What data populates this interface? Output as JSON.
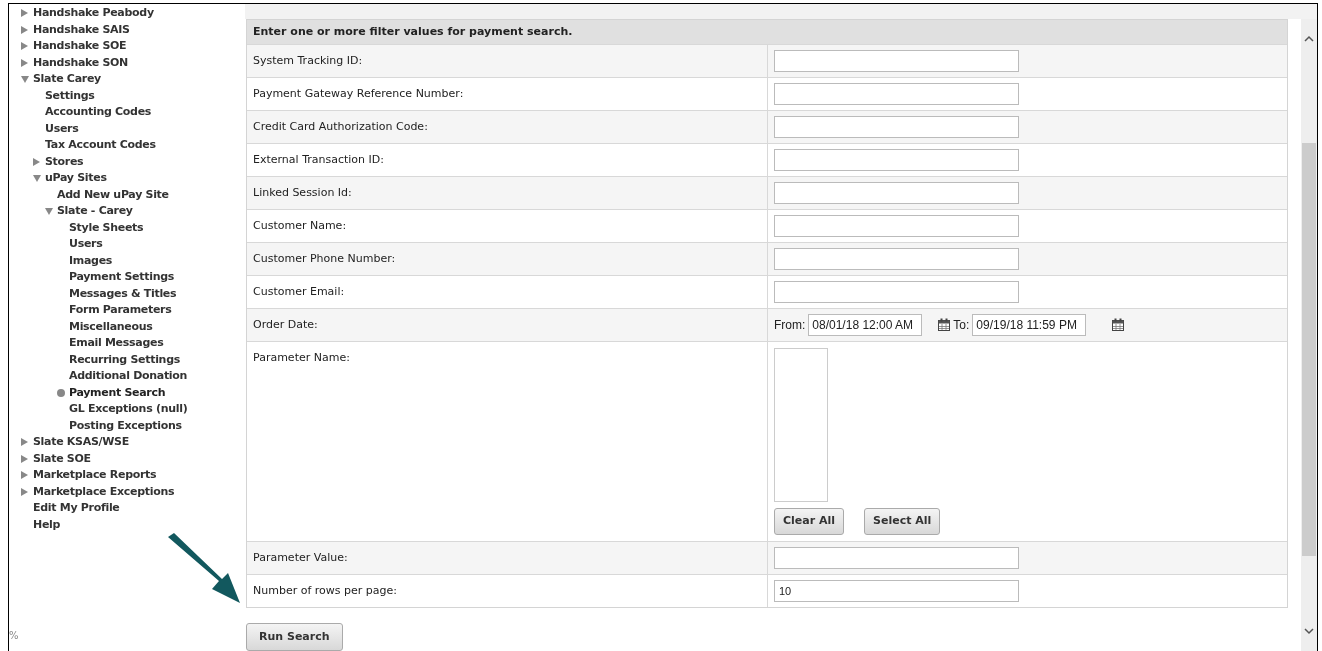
{
  "sidebar": {
    "items": [
      {
        "label": "Handshake Peabody",
        "kind": "collapsed",
        "selected": false
      },
      {
        "label": "Handshake SAIS",
        "kind": "collapsed",
        "selected": false
      },
      {
        "label": "Handshake SOE",
        "kind": "collapsed",
        "selected": false
      },
      {
        "label": "Handshake SON",
        "kind": "collapsed",
        "selected": false
      },
      {
        "label": "Slate Carey",
        "kind": "expanded",
        "selected": false,
        "children": [
          {
            "label": "Settings",
            "kind": "leaf",
            "selected": false
          },
          {
            "label": "Accounting Codes",
            "kind": "leaf",
            "selected": false
          },
          {
            "label": "Users",
            "kind": "leaf",
            "selected": false
          },
          {
            "label": "Tax Account Codes",
            "kind": "leaf",
            "selected": false
          },
          {
            "label": "Stores",
            "kind": "collapsed",
            "selected": false
          },
          {
            "label": "uPay Sites",
            "kind": "expanded",
            "selected": false,
            "children": [
              {
                "label": "Add New uPay Site",
                "kind": "leaf",
                "selected": false
              },
              {
                "label": "Slate - Carey",
                "kind": "expanded",
                "selected": false,
                "children": [
                  {
                    "label": "Style Sheets",
                    "kind": "leaf",
                    "selected": false
                  },
                  {
                    "label": "Users",
                    "kind": "leaf",
                    "selected": false
                  },
                  {
                    "label": "Images",
                    "kind": "leaf",
                    "selected": false
                  },
                  {
                    "label": "Payment Settings",
                    "kind": "leaf",
                    "selected": false
                  },
                  {
                    "label": "Messages & Titles",
                    "kind": "leaf",
                    "selected": false
                  },
                  {
                    "label": "Form Parameters",
                    "kind": "leaf",
                    "selected": false
                  },
                  {
                    "label": "Miscellaneous",
                    "kind": "leaf",
                    "selected": false
                  },
                  {
                    "label": "Email Messages",
                    "kind": "leaf",
                    "selected": false
                  },
                  {
                    "label": "Recurring Settings",
                    "kind": "leaf",
                    "selected": false
                  },
                  {
                    "label": "Additional Donation",
                    "kind": "leaf",
                    "selected": false
                  },
                  {
                    "label": "Payment Search",
                    "kind": "leaf",
                    "selected": true
                  },
                  {
                    "label": "GL Exceptions (null)",
                    "kind": "leaf",
                    "selected": false
                  },
                  {
                    "label": "Posting Exceptions",
                    "kind": "leaf",
                    "selected": false
                  }
                ]
              }
            ]
          }
        ]
      },
      {
        "label": "Slate KSAS/WSE",
        "kind": "collapsed",
        "selected": false
      },
      {
        "label": "Slate SOE",
        "kind": "collapsed",
        "selected": false
      },
      {
        "label": "Marketplace Reports",
        "kind": "collapsed",
        "selected": false
      },
      {
        "label": "Marketplace Exceptions",
        "kind": "collapsed",
        "selected": false
      },
      {
        "label": "Edit My Profile",
        "kind": "leaf",
        "selected": false
      },
      {
        "label": "Help",
        "kind": "leaf",
        "selected": false
      }
    ]
  },
  "zoom_label": "%",
  "form": {
    "heading": "Enter one or more filter values for payment search.",
    "rows": [
      {
        "label": "System Tracking ID:",
        "kind": "text"
      },
      {
        "label": "Payment Gateway Reference Number:",
        "kind": "text"
      },
      {
        "label": "Credit Card Authorization Code:",
        "kind": "text"
      },
      {
        "label": "External Transaction ID:",
        "kind": "text"
      },
      {
        "label": "Linked Session Id:",
        "kind": "text"
      },
      {
        "label": "Customer Name:",
        "kind": "text"
      },
      {
        "label": "Customer Phone Number:",
        "kind": "text"
      },
      {
        "label": "Customer Email:",
        "kind": "text"
      },
      {
        "label": "Order Date:",
        "kind": "daterange",
        "from_label": "From:",
        "from_value": "08/01/18 12:00 AM",
        "to_label": "To:",
        "to_value": "09/19/18 11:59 PM"
      },
      {
        "label": "Parameter Name:",
        "kind": "listbox",
        "buttons": [
          "Clear All",
          "Select All"
        ]
      },
      {
        "label": "Parameter Value:",
        "kind": "text"
      },
      {
        "label": "Number of rows per page:",
        "kind": "text",
        "value": "10"
      }
    ]
  },
  "submit": "Run Search"
}
